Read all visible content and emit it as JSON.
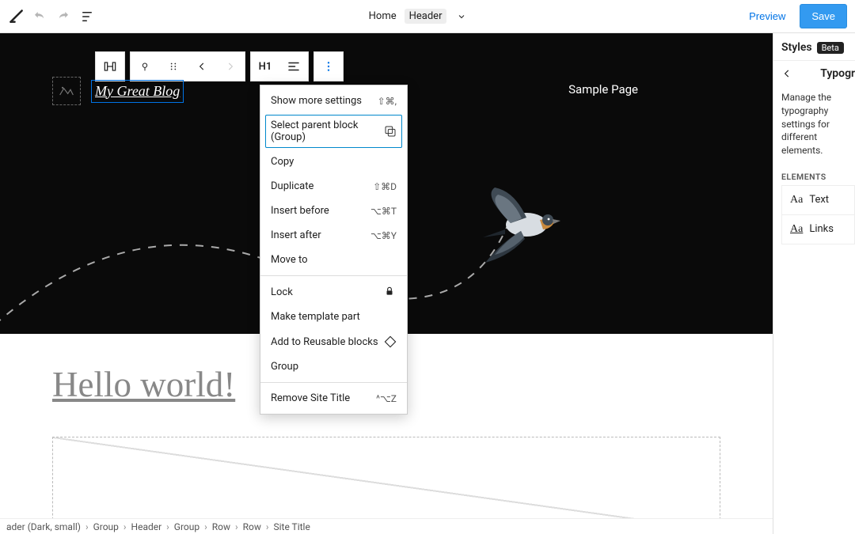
{
  "topbar": {
    "crumb_home": "Home",
    "crumb_current": "Header",
    "preview": "Preview",
    "save": "Save"
  },
  "block_toolbar": {
    "heading_tag": "H1"
  },
  "page": {
    "site_title": "My Great Blog",
    "nav_item": "Sample Page",
    "post_title": "Hello world!"
  },
  "context_menu": {
    "show_more": "Show more settings",
    "show_more_sc": "⇧⌘,",
    "select_parent": "Select parent block (Group)",
    "copy": "Copy",
    "duplicate": "Duplicate",
    "duplicate_sc": "⇧⌘D",
    "insert_before": "Insert before",
    "insert_before_sc": "⌥⌘T",
    "insert_after": "Insert after",
    "insert_after_sc": "⌥⌘Y",
    "move_to": "Move to",
    "lock": "Lock",
    "make_template": "Make template part",
    "add_reusable": "Add to Reusable blocks",
    "group": "Group",
    "remove": "Remove Site Title",
    "remove_sc": "^⌥Z"
  },
  "sidebar": {
    "styles": "Styles",
    "beta": "Beta",
    "typography": "Typography",
    "desc": "Manage the typography settings for different elements.",
    "elements_label": "Elements",
    "items": [
      {
        "label": "Text"
      },
      {
        "label": "Links"
      }
    ]
  },
  "breadcrumbs": [
    "ader (Dark, small)",
    "Group",
    "Header",
    "Group",
    "Row",
    "Row",
    "Site Title"
  ]
}
